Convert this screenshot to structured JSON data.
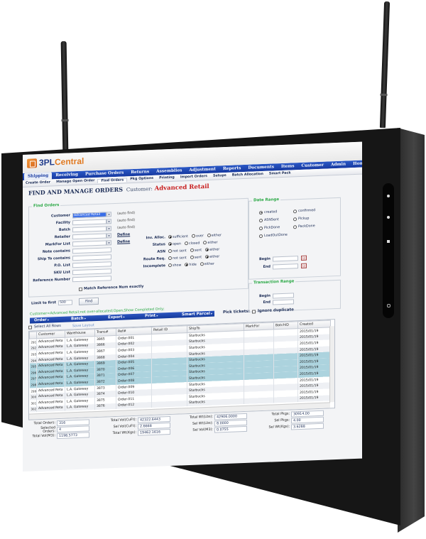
{
  "app": {
    "logo_text_a": "3PL",
    "logo_text_b": "Central"
  },
  "main_nav": [
    "Shipping",
    "Receiving",
    "Purchase Orders",
    "Returns",
    "Assemblies",
    "Adjustment",
    "Reports",
    "Documents",
    "Items",
    "Customer",
    "Admin",
    "Home"
  ],
  "main_nav_active": "Shipping",
  "sub_nav": [
    "Create Order",
    "Manage Open Order",
    "Find Orders",
    "Pkg Options",
    "Printing",
    "Import Orders",
    "Setups",
    "Batch Allocation",
    "Smart Pack"
  ],
  "sub_nav_active": "Find Orders",
  "page": {
    "title": "Find and Manage Orders",
    "customer_label": "Customer:",
    "customer_name": "Advanced Retail"
  },
  "find_orders": {
    "legend": "Find Orders",
    "fields": [
      {
        "label": "Customer",
        "value": "Advanced Retail",
        "dropdown": true,
        "hint": "(auto find)"
      },
      {
        "label": "Facility",
        "value": "",
        "dropdown": true,
        "hint": "(auto find)"
      },
      {
        "label": "Batch",
        "value": "",
        "dropdown": true,
        "hint": "(auto find)"
      },
      {
        "label": "Retailer",
        "value": "",
        "dropdown": true,
        "link": "Define"
      },
      {
        "label": "MarkFor List",
        "value": "",
        "dropdown": true,
        "link": "Define"
      },
      {
        "label": "Note contains",
        "value": ""
      },
      {
        "label": "Ship To contains",
        "value": ""
      },
      {
        "label": "P.O. List",
        "value": ""
      },
      {
        "label": "SKU List",
        "value": ""
      },
      {
        "label": "Reference Number",
        "value": ""
      }
    ],
    "match_ref_label": "Match Reference Num exactly",
    "radio_groups": [
      {
        "label": "Inv. Alloc.",
        "options": [
          "sufficient",
          "over",
          "either"
        ],
        "selected": "sufficient"
      },
      {
        "label": "Status",
        "options": [
          "open",
          "closed",
          "either"
        ],
        "selected": "open"
      },
      {
        "label": "ASN",
        "options": [
          "not sent",
          "sent",
          "either"
        ],
        "selected": "either"
      },
      {
        "label": "Route Req.",
        "options": [
          "not sent",
          "sent",
          "either"
        ],
        "selected": "either"
      },
      {
        "label": "Incomplete",
        "options": [
          "show",
          "hide",
          "either"
        ],
        "selected": "hide"
      }
    ]
  },
  "date_range": {
    "legend": "Date Range",
    "options": [
      "created",
      "confirmed",
      "ASNSent",
      "Pickup",
      "PickDone",
      "PackDone",
      "LoadOutDone"
    ],
    "selected": "created",
    "begin_label": "Begin",
    "end_label": "End",
    "calendar_glyph": "12"
  },
  "transaction_range": {
    "legend": "Transaction Range",
    "begin_label": "Begin",
    "end_label": "End"
  },
  "limit": {
    "label": "Limit to first",
    "value": "500",
    "find_button": "Find"
  },
  "filter_summary": "Customer=Advanced Retail;not over-allocated;Open;Show Completed Only;",
  "action_bar": [
    "Order",
    "Batch",
    "Export",
    "Print",
    "Smart Parcel"
  ],
  "pick_tickets": {
    "label": "Pick tickets:",
    "ignore_duplicate": "Ignore duplicate"
  },
  "select_all_rows": "Select All Rows",
  "save_layout": "Save Layout",
  "grid": {
    "columns": [
      "",
      "Customer",
      "Warehouse",
      "Trans#",
      "Ref#",
      "Retail ID",
      "ShipTo",
      "MarkFor",
      "BatchID",
      "Created"
    ],
    "rows": [
      {
        "n": "291",
        "customer": "Advanced Reta",
        "warehouse": "L.A. Gateway",
        "trans": "3865",
        "ref": "Order-001",
        "ship": "Starbucks",
        "created": "2015/01/19",
        "style": "normal"
      },
      {
        "n": "292",
        "customer": "Advanced Reta",
        "warehouse": "L.A. Gateway",
        "trans": "3866",
        "ref": "Order-002",
        "ship": "Starbucks",
        "created": "2015/01/19",
        "style": "alt"
      },
      {
        "n": "293",
        "customer": "Advanced Reta",
        "warehouse": "L.A. Gateway",
        "trans": "3867",
        "ref": "Order-003",
        "ship": "Starbucks",
        "created": "2015/01/19",
        "style": "normal"
      },
      {
        "n": "294",
        "customer": "Advanced Reta",
        "warehouse": "L.A. Gateway",
        "trans": "3868",
        "ref": "Order-004",
        "ship": "Starbucks",
        "created": "2015/01/19",
        "style": "alt"
      },
      {
        "n": "295",
        "customer": "Advanced Reta",
        "warehouse": "L.A. Gateway",
        "trans": "3869",
        "ref": "Order-005",
        "ship": "Starbucks",
        "created": "2015/01/19",
        "style": "hl"
      },
      {
        "n": "296",
        "customer": "Advanced Reta",
        "warehouse": "L.A. Gateway",
        "trans": "3870",
        "ref": "Order-006",
        "ship": "Starbucks",
        "created": "2015/01/19",
        "style": "hl"
      },
      {
        "n": "297",
        "customer": "Advanced Reta",
        "warehouse": "L.A. Gateway",
        "trans": "3871",
        "ref": "Order-007",
        "ship": "Starbucks",
        "created": "2015/01/19",
        "style": "hl"
      },
      {
        "n": "298",
        "customer": "Advanced Reta",
        "warehouse": "L.A. Gateway",
        "trans": "3872",
        "ref": "Order-008",
        "ship": "Starbucks",
        "created": "2015/01/19",
        "style": "hl"
      },
      {
        "n": "299",
        "customer": "Advanced Reta",
        "warehouse": "L.A. Gateway",
        "trans": "3873",
        "ref": "Order-009",
        "ship": "Starbucks",
        "created": "2015/01/19",
        "style": "normal"
      },
      {
        "n": "300",
        "customer": "Advanced Reta",
        "warehouse": "L.A. Gateway",
        "trans": "3874",
        "ref": "Order-010",
        "ship": "Starbucks",
        "created": "2015/01/19",
        "style": "alt"
      },
      {
        "n": "301",
        "customer": "Advanced Reta",
        "warehouse": "L.A. Gateway",
        "trans": "3875",
        "ref": "Order-011",
        "ship": "Starbucks",
        "created": "2015/01/19",
        "style": "normal"
      },
      {
        "n": "302",
        "customer": "Advanced Reta",
        "warehouse": "L.A. Gateway",
        "trans": "3876",
        "ref": "Order-012",
        "ship": "Starbucks",
        "created": "2015/01/19",
        "style": "alt"
      }
    ]
  },
  "totals": {
    "col1": [
      {
        "label": "Total Orders:",
        "value": "316"
      },
      {
        "label": "Selected Orders:",
        "value": "4"
      },
      {
        "label": "Total Vol(M3):",
        "value": "1198.5773"
      }
    ],
    "col2": [
      {
        "label": "Total Vol(CuFt):",
        "value": "42322.6443"
      },
      {
        "label": "Sel Vol(CuFt):",
        "value": "2.6668"
      },
      {
        "label": "Total Wt(Kgs):",
        "value": "19462.1616"
      }
    ],
    "col3": [
      {
        "label": "Total Wt(Lbs):",
        "value": "42906.0000"
      },
      {
        "label": "Sel Wt(Lbs):",
        "value": "8.0000"
      },
      {
        "label": "Sel Vol(M3):",
        "value": "0.0755"
      }
    ],
    "col4": [
      {
        "label": "Total Pkgs:",
        "value": "30914.00"
      },
      {
        "label": "Sel Pkgs:",
        "value": "4.00"
      },
      {
        "label": "Sel Wt(Kgs):",
        "value": "3.6288"
      }
    ]
  },
  "colors": {
    "nav_blue": "#1739a0",
    "legend_green": "#2aa845",
    "customer_red": "#c81e1e",
    "row_highlight": "#acd3de",
    "logo_orange": "#e07a22"
  }
}
